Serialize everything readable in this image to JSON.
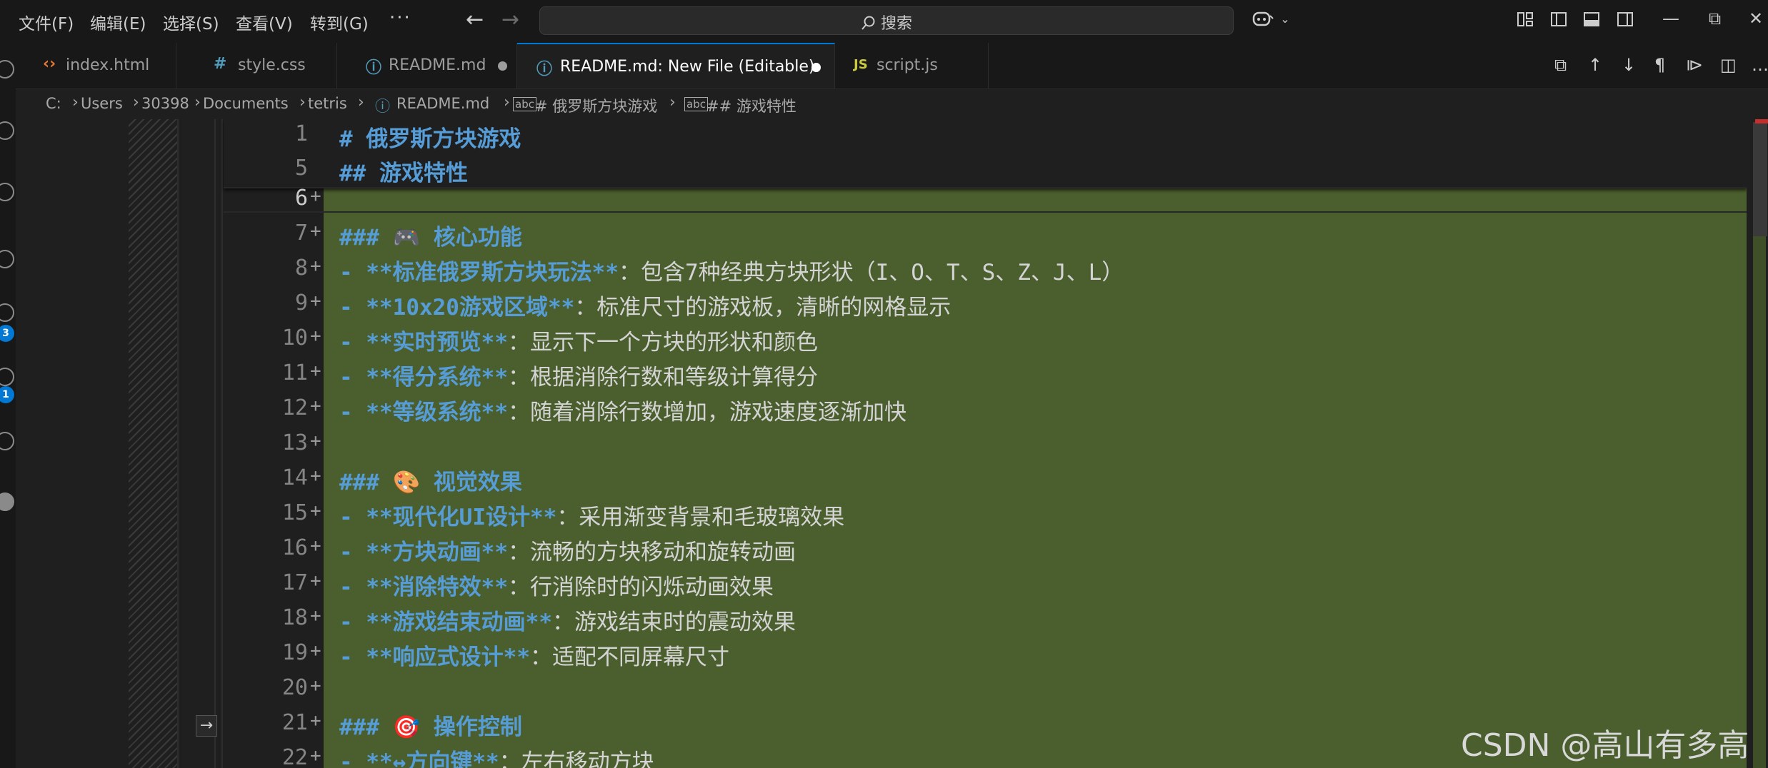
{
  "menu": {
    "file": "文件(F)",
    "edit": "编辑(E)",
    "selection": "选择(S)",
    "view": "查看(V)",
    "goto": "转到(G)",
    "more": "···"
  },
  "search": {
    "label": "搜索"
  },
  "activity_badges": {
    "source_control": "3",
    "extensions": "1"
  },
  "tabs": [
    {
      "label": "index.html",
      "icon": "‹›",
      "icon_color": "#e37933",
      "modified": false,
      "active": false
    },
    {
      "label": "style.css",
      "icon": "#",
      "icon_color": "#519aba",
      "modified": false,
      "active": false
    },
    {
      "label": "README.md",
      "icon": "ⓘ",
      "icon_color": "#519aba",
      "modified": true,
      "active": false
    },
    {
      "label": "README.md: New File (Editable)",
      "icon": "ⓘ",
      "icon_color": "#519aba",
      "modified": true,
      "active": true
    },
    {
      "label": "script.js",
      "icon": "JS",
      "icon_color": "#cbcb41",
      "modified": false,
      "active": false
    }
  ],
  "breadcrumb": {
    "items": [
      "C:",
      "Users",
      "30398",
      "Documents",
      "tetris",
      "README.md",
      "# 俄罗斯方块游戏",
      "## 游戏特性"
    ]
  },
  "editor": {
    "sticky_lines": [
      {
        "num": "1",
        "head": "# 俄罗斯方块游戏",
        "text": ""
      },
      {
        "num": "5",
        "head": "## 游戏特性",
        "text": ""
      }
    ],
    "lines": [
      {
        "num": "6",
        "bold": "",
        "text": ""
      },
      {
        "num": "7",
        "bold": "### 🎮 核心功能",
        "text": ""
      },
      {
        "num": "8",
        "bold": "- **标准俄罗斯方块玩法**",
        "text": "：包含7种经典方块形状（I、O、T、S、Z、J、L）"
      },
      {
        "num": "9",
        "bold": "- **10x20游戏区域**",
        "text": "：标准尺寸的游戏板，清晰的网格显示"
      },
      {
        "num": "10",
        "bold": "- **实时预览**",
        "text": "：显示下一个方块的形状和颜色"
      },
      {
        "num": "11",
        "bold": "- **得分系统**",
        "text": "：根据消除行数和等级计算得分"
      },
      {
        "num": "12",
        "bold": "- **等级系统**",
        "text": "：随着消除行数增加，游戏速度逐渐加快"
      },
      {
        "num": "13",
        "bold": "",
        "text": ""
      },
      {
        "num": "14",
        "bold": "### 🎨 视觉效果",
        "text": ""
      },
      {
        "num": "15",
        "bold": "- **现代化UI设计**",
        "text": "：采用渐变背景和毛玻璃效果"
      },
      {
        "num": "16",
        "bold": "- **方块动画**",
        "text": "：流畅的方块移动和旋转动画"
      },
      {
        "num": "17",
        "bold": "- **消除特效**",
        "text": "：行消除时的闪烁动画效果"
      },
      {
        "num": "18",
        "bold": "- **游戏结束动画**",
        "text": "：游戏结束时的震动效果"
      },
      {
        "num": "19",
        "bold": "- **响应式设计**",
        "text": "：适配不同屏幕尺寸"
      },
      {
        "num": "20",
        "bold": "",
        "text": ""
      },
      {
        "num": "21",
        "bold": "### 🎯 操作控制",
        "text": ""
      },
      {
        "num": "22",
        "bold": "- **↔方向键**",
        "text": "：左右移动方块"
      }
    ],
    "added_marker": "+"
  },
  "watermark": "CSDN @高山有多高",
  "colors": {
    "accent": "#0078d4",
    "diff_added_bg": "#4b5e2d",
    "heading": "#569cd6"
  }
}
